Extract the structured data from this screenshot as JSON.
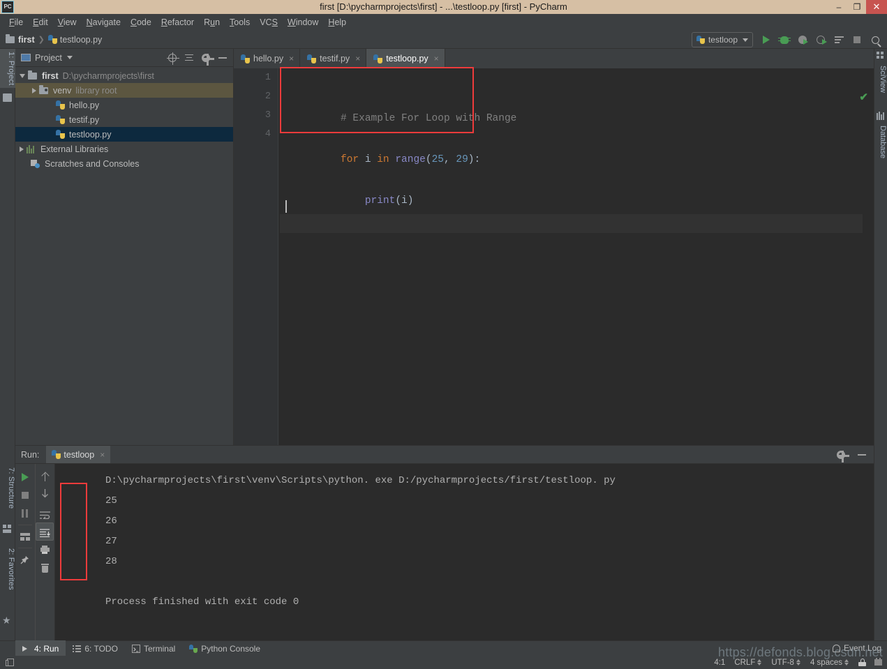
{
  "window": {
    "title": "first [D:\\pycharmprojects\\first] - ...\\testloop.py [first] - PyCharm",
    "logo_text": "PC",
    "minimize": "–",
    "maximize": "❐",
    "close": "✕"
  },
  "menubar": {
    "items": [
      {
        "label": "File",
        "mnemonic": "F"
      },
      {
        "label": "Edit",
        "mnemonic": "E"
      },
      {
        "label": "View",
        "mnemonic": "V"
      },
      {
        "label": "Navigate",
        "mnemonic": "N"
      },
      {
        "label": "Code",
        "mnemonic": "C"
      },
      {
        "label": "Refactor",
        "mnemonic": "R"
      },
      {
        "label": "Run",
        "mnemonic": "u"
      },
      {
        "label": "Tools",
        "mnemonic": "T"
      },
      {
        "label": "VCS",
        "mnemonic": "S"
      },
      {
        "label": "Window",
        "mnemonic": "W"
      },
      {
        "label": "Help",
        "mnemonic": "H"
      }
    ]
  },
  "navbar": {
    "crumbs": [
      "first",
      "testloop.py"
    ],
    "separator": "❯",
    "run_config": "testloop",
    "buttons": [
      "run-button",
      "debug-button",
      "coverage-button",
      "profile-button",
      "run-with-console-button",
      "stop-button",
      "search-everywhere-button"
    ]
  },
  "left_tool_tabs": [
    {
      "label": "1: Project",
      "active": true,
      "icon": "folder-icon"
    },
    {
      "label": "7: Structure",
      "active": false,
      "icon": "structure-icon"
    },
    {
      "label": "2: Favorites",
      "active": false,
      "icon": "star-icon"
    }
  ],
  "right_tool_tabs": [
    {
      "label": "SciView",
      "icon": "grid-icon"
    },
    {
      "label": "Database",
      "icon": "database-icon"
    }
  ],
  "project_panel": {
    "title": "Project",
    "header_buttons": [
      "locate-target-icon",
      "collapse-all-icon",
      "settings-gear-icon",
      "hide-icon"
    ],
    "tree": [
      {
        "label": "first",
        "detail": "D:\\pycharmprojects\\first",
        "depth": 0,
        "arrow": "open",
        "icon": "folder-icon",
        "bold": true,
        "state": "none"
      },
      {
        "label": "venv",
        "detail": "library root",
        "depth": 1,
        "arrow": "closed",
        "icon": "folder-venv-icon",
        "bold": false,
        "state": "highlight"
      },
      {
        "label": "hello.py",
        "detail": "",
        "depth": 2,
        "arrow": "none",
        "icon": "python-file-icon",
        "bold": false,
        "state": "none"
      },
      {
        "label": "testif.py",
        "detail": "",
        "depth": 2,
        "arrow": "none",
        "icon": "python-file-icon",
        "bold": false,
        "state": "none"
      },
      {
        "label": "testloop.py",
        "detail": "",
        "depth": 2,
        "arrow": "none",
        "icon": "python-file-icon",
        "bold": false,
        "state": "selected"
      },
      {
        "label": "External Libraries",
        "detail": "",
        "depth": 0,
        "arrow": "closed",
        "icon": "libraries-icon",
        "bold": false,
        "state": "none"
      },
      {
        "label": "Scratches and Consoles",
        "detail": "",
        "depth": 0,
        "arrow": "none",
        "icon": "scratches-icon",
        "bold": false,
        "state": "none"
      }
    ]
  },
  "editor": {
    "tabs": [
      {
        "label": "hello.py",
        "active": false
      },
      {
        "label": "testif.py",
        "active": false
      },
      {
        "label": "testloop.py",
        "active": true
      }
    ],
    "tab_close": "×",
    "line_numbers": [
      "1",
      "2",
      "3",
      "4"
    ],
    "code_lines": [
      [
        {
          "t": "# Example For Loop with Range",
          "c": "comment"
        }
      ],
      [
        {
          "t": "for",
          "c": "kw"
        },
        {
          "t": " i ",
          "c": "plain"
        },
        {
          "t": "in",
          "c": "kw"
        },
        {
          "t": " ",
          "c": "plain"
        },
        {
          "t": "range",
          "c": "fn"
        },
        {
          "t": "(",
          "c": "plain"
        },
        {
          "t": "25",
          "c": "num"
        },
        {
          "t": ", ",
          "c": "plain"
        },
        {
          "t": "29",
          "c": "num"
        },
        {
          "t": "):",
          "c": "plain"
        }
      ],
      [
        {
          "t": "    ",
          "c": "plain"
        },
        {
          "t": "print",
          "c": "fn"
        },
        {
          "t": "(i)",
          "c": "plain"
        }
      ],
      [
        {
          "t": "",
          "c": "plain"
        }
      ]
    ],
    "inspection_status": "✔"
  },
  "run_panel": {
    "label": "Run:",
    "tab_name": "testloop",
    "tab_close": "×",
    "header_buttons": [
      "settings-gear-icon",
      "hide-icon"
    ],
    "toolbar_left": [
      "rerun-button",
      "stop-button",
      "pause-output-button",
      "layout-button",
      "pin-tab-button"
    ],
    "toolbar_right": [
      "up-stacktrace-button",
      "down-stacktrace-button",
      "soft-wrap-button",
      "scroll-to-end-button",
      "print-button",
      "clear-all-button"
    ],
    "console_lines": [
      "D:\\pycharmprojects\\first\\venv\\Scripts\\python. exe D:/pycharmprojects/first/testloop. py",
      "25",
      "26",
      "27",
      "28",
      "",
      "Process finished with exit code 0"
    ],
    "output_values": [
      "25",
      "26",
      "27",
      "28"
    ],
    "exit_message": "Process finished with exit code 0"
  },
  "bottom_tabs": [
    {
      "label": "4: Run",
      "mnemonic": "4",
      "icon": "run-icon",
      "active": true
    },
    {
      "label": "6: TODO",
      "mnemonic": "6",
      "icon": "todo-icon",
      "active": false
    },
    {
      "label": "Terminal",
      "mnemonic": "",
      "icon": "terminal-icon",
      "active": false
    },
    {
      "label": "Python Console",
      "mnemonic": "",
      "icon": "python-console-icon",
      "active": false
    }
  ],
  "event_log": {
    "label": "Event Log",
    "icon": "bell-icon"
  },
  "statusbar": {
    "caret_position": "4:1",
    "line_separator": "CRLF",
    "encoding": "UTF-8",
    "indent": "4 spaces",
    "icons": [
      "lock-icon",
      "memory-icon"
    ]
  },
  "watermark": "https://defonds.blog.csdn.net",
  "colors": {
    "titlebar": "#d6bfa4",
    "chrome": "#3c3f41",
    "editor_bg": "#2b2b2b",
    "accent_blue": "#4a88c7",
    "selection": "#0d293e",
    "highlight_red": "#ee3b3b",
    "green_run": "#499c54",
    "keyword_orange": "#cc7832",
    "number_blue": "#6897bb",
    "function_purple": "#8888c6"
  }
}
